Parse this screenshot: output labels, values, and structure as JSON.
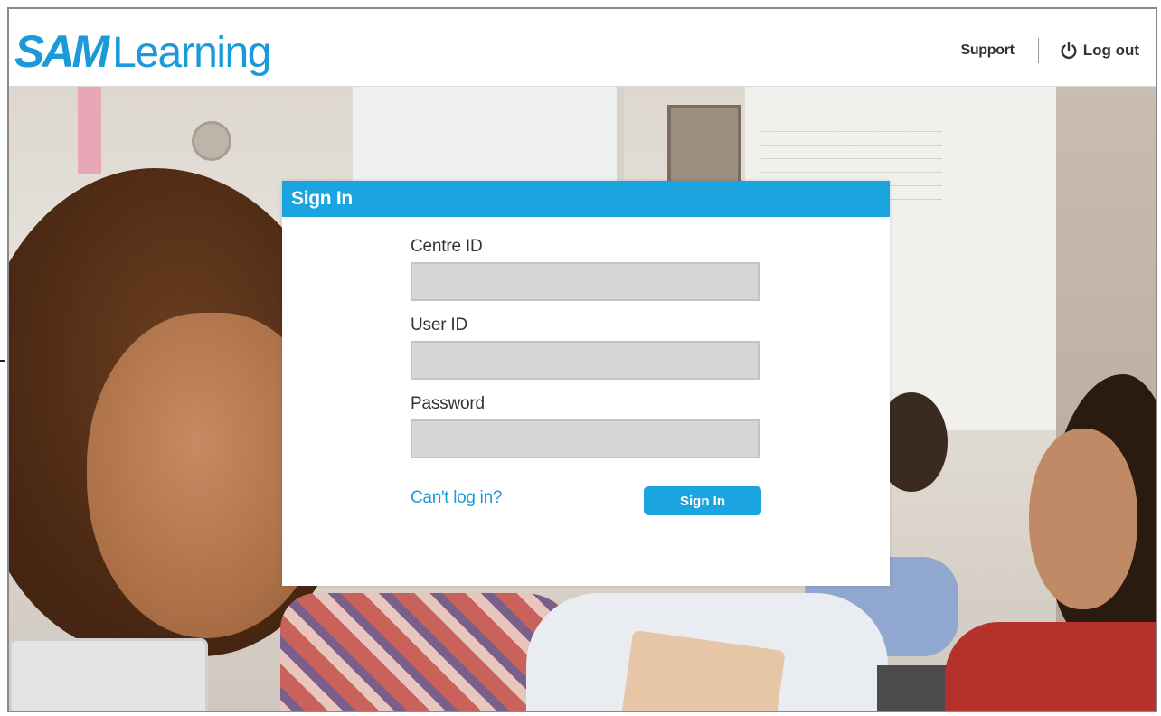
{
  "brand": {
    "logo_sam": "SAM",
    "logo_learning": "Learning",
    "color": "#1a9bd7"
  },
  "topnav": {
    "support_label": "Support",
    "logout_label": "Log out",
    "logout_icon": "power-icon"
  },
  "dialog": {
    "title": "Sign In",
    "header_color": "#1aa5e0",
    "fields": [
      {
        "label": "Centre ID",
        "value": ""
      },
      {
        "label": "User ID",
        "value": ""
      },
      {
        "label": "Password",
        "value": ""
      }
    ],
    "cant_login_label": "Can't log in?",
    "sign_in_button": "Sign In"
  }
}
